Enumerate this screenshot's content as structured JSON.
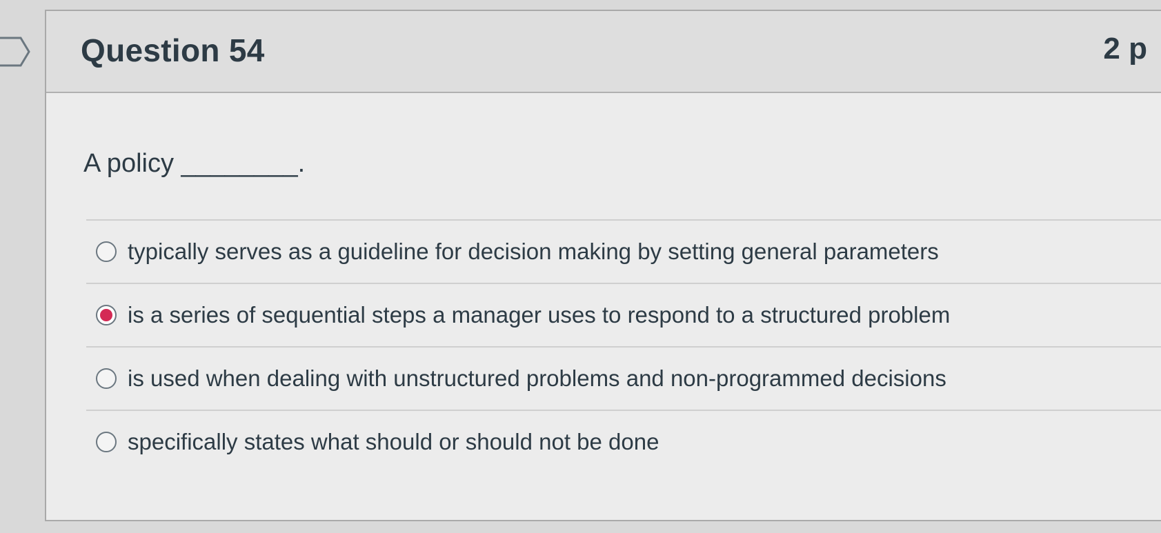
{
  "question": {
    "title": "Question 54",
    "points": "2 p",
    "text": "A policy ________."
  },
  "answers": [
    {
      "label": "typically serves as a guideline for decision making by setting general parameters",
      "selected": false
    },
    {
      "label": "is a series of sequential steps a manager uses to respond to a structured problem",
      "selected": true
    },
    {
      "label": "is used when dealing with unstructured problems and non-programmed decisions",
      "selected": false
    },
    {
      "label": "specifically states what should or should not be done",
      "selected": false
    }
  ],
  "colors": {
    "selected_radio": "#d42a55",
    "text": "#2d3b45",
    "header_bg": "#dedede",
    "card_bg": "#ececec"
  },
  "icons": {
    "flag": "question-flag-icon"
  }
}
